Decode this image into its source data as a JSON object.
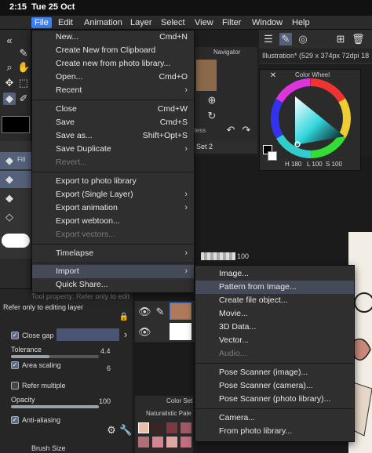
{
  "status": {
    "time": "2:15",
    "date": "Tue 25 Oct"
  },
  "menubar": [
    "File",
    "Edit",
    "Animation",
    "Layer",
    "Select",
    "View",
    "Filter",
    "Window",
    "Help"
  ],
  "file_menu": {
    "items": [
      {
        "label": "New...",
        "shortcut": "Cmd+N"
      },
      {
        "label": "Create New from Clipboard"
      },
      {
        "label": "Create new from photo library..."
      },
      {
        "label": "Open...",
        "shortcut": "Cmd+O"
      },
      {
        "label": "Recent",
        "submenu": true
      },
      {
        "label": "Close",
        "shortcut": "Cmd+W"
      },
      {
        "label": "Save",
        "shortcut": "Cmd+S"
      },
      {
        "label": "Save as...",
        "shortcut": "Shift+Opt+S"
      },
      {
        "label": "Save Duplicate",
        "submenu": true
      },
      {
        "label": "Revert...",
        "disabled": true
      },
      {
        "label": "Export to photo library"
      },
      {
        "label": "Export (Single Layer)",
        "submenu": true
      },
      {
        "label": "Export animation",
        "submenu": true
      },
      {
        "label": "Export webtoon..."
      },
      {
        "label": "Export vectors...",
        "disabled": true
      },
      {
        "label": "Timelapse",
        "submenu": true
      },
      {
        "label": "Import",
        "submenu": true,
        "highlighted": true
      },
      {
        "label": "Quick Share..."
      }
    ]
  },
  "import_menu": {
    "items": [
      {
        "label": "Image..."
      },
      {
        "label": "Pattern from Image...",
        "highlighted": true
      },
      {
        "label": "Create file object..."
      },
      {
        "label": "Movie..."
      },
      {
        "label": "3D Data..."
      },
      {
        "label": "Vector..."
      },
      {
        "label": "Audio...",
        "disabled": true
      },
      {
        "label": "Pose Scanner (image)..."
      },
      {
        "label": "Pose Scanner (camera)..."
      },
      {
        "label": "Pose Scanner (photo library)..."
      },
      {
        "label": "Camera..."
      },
      {
        "label": "From photo library..."
      }
    ]
  },
  "panels": {
    "navigator": "Navigator",
    "illustration_tab": "Illustration* (529 x 374px 72dpi 18",
    "color_wheel": "Color Wheel",
    "color_h": "H 180",
    "color_l": "L 100",
    "color_s": "S 100",
    "set_label": "Set 2",
    "less_label": "less",
    "opacity_value": "100",
    "color_set": "Color Set",
    "naturalistic": "Naturalistic Pale"
  },
  "tool_property": {
    "header": "Tool property: Refer only to editing l",
    "refer_label": "Refer only to editing layer",
    "fill_label": "Fill",
    "close_gap": "Close gap",
    "tolerance_label": "Tolerance",
    "tolerance_value": "4.4",
    "area_scaling_label": "Area scaling",
    "area_scaling_value": "6",
    "refer_multiple": "Refer multiple",
    "opacity_label": "Opacity",
    "opacity_value": "100",
    "anti_aliasing": "Anti-aliasing",
    "brush_size": "Brush Size",
    "tolerance_level": 0.44,
    "opacity_level": 1.0
  },
  "colors": {
    "menu_active": "#3b82f6",
    "highlight": "#444a57"
  }
}
